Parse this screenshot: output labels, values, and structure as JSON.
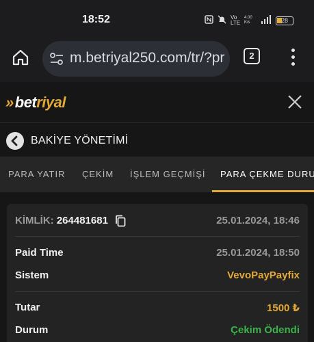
{
  "status_bar": {
    "time": "18:52",
    "battery": "28",
    "network": "Vo LTE",
    "speed": "4.00 K/s"
  },
  "browser": {
    "url": "m.betriyal250.com/tr/?pr",
    "tab_count": "2"
  },
  "site": {
    "logo_bet": "bet",
    "logo_riyal": "riyal",
    "logo_chevron": "»"
  },
  "section": {
    "title": "BAKİYE YÖNETİMİ"
  },
  "tabs": [
    {
      "label": "PARA YATIR"
    },
    {
      "label": "ÇEKİM"
    },
    {
      "label": "İŞLEM GEÇMİŞİ"
    },
    {
      "label": "PARA ÇEKME DURUMU"
    }
  ],
  "transaction": {
    "id_label": "KİMLİK:",
    "id_value": "264481681",
    "created_at": "25.01.2024, 18:46",
    "paid_time_label": "Paid Time",
    "paid_time_value": "25.01.2024, 18:50",
    "system_label": "Sistem",
    "system_value": "VevoPayPayfix",
    "amount_label": "Tutar",
    "amount_value": "1500 ₺",
    "status_label": "Durum",
    "status_value": "Çekim Ödendi"
  },
  "colors": {
    "accent": "#e2a838",
    "success": "#3bb24a",
    "background": "#161616"
  }
}
